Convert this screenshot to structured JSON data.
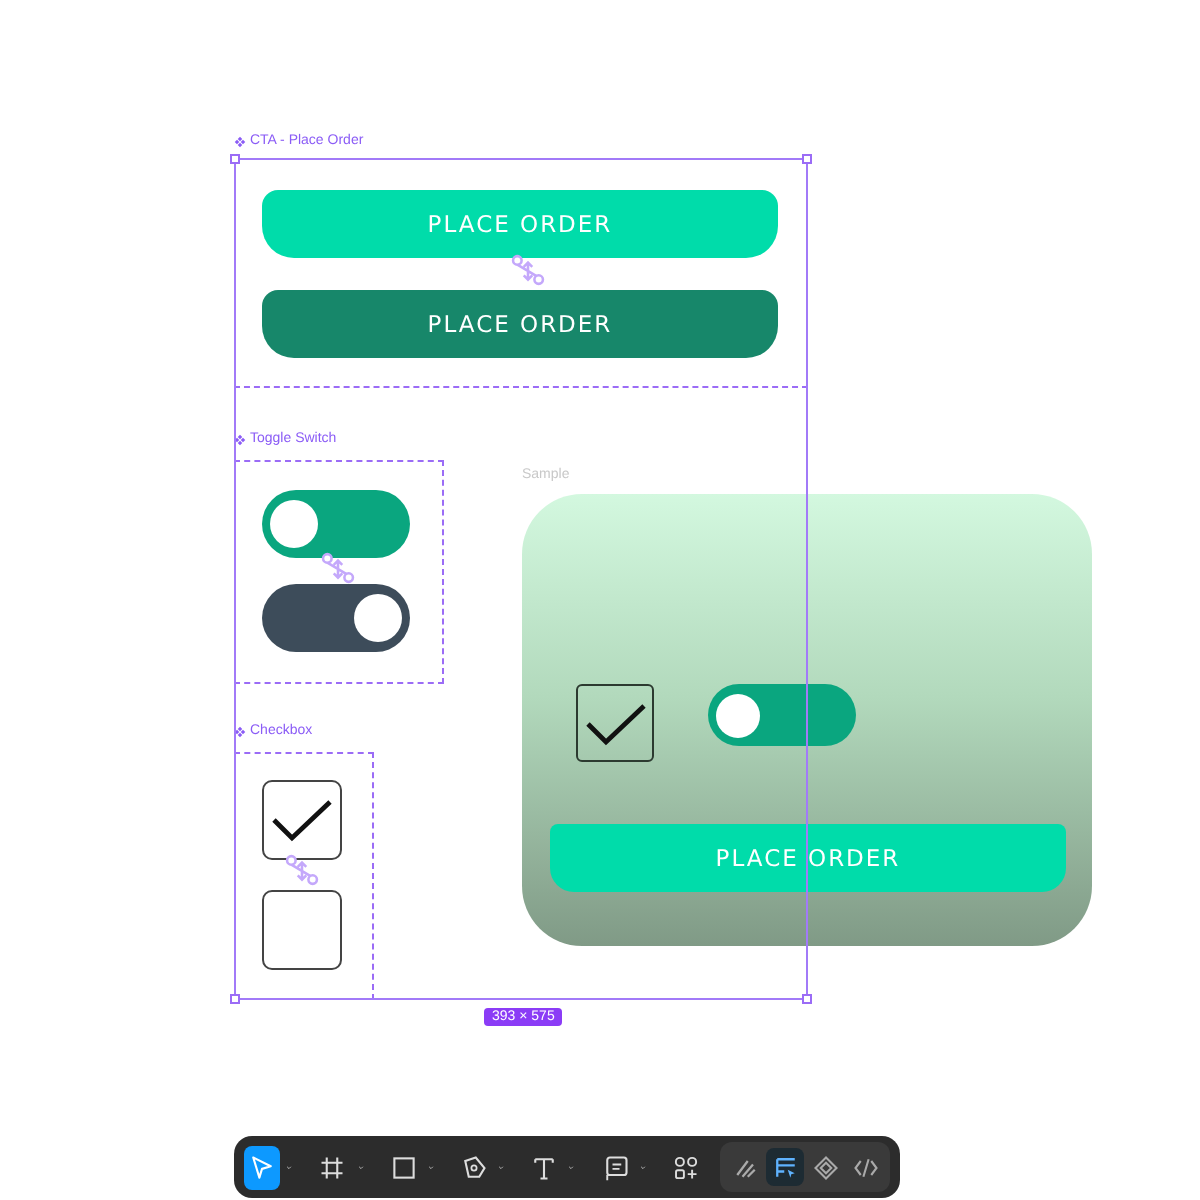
{
  "selection": {
    "size": "393 × 575"
  },
  "component_sets": [
    {
      "kind": "buttons",
      "label": "CTA - Place Order",
      "items": [
        {
          "label": "PLACE ORDER",
          "pressed": false
        },
        {
          "label": "PLACE ORDER",
          "pressed": true
        }
      ]
    },
    {
      "kind": "toggles",
      "label": "Toggle Switch",
      "items": [
        {
          "kind": "default"
        },
        {
          "kind": "alternate"
        }
      ]
    },
    {
      "kind": "checkboxes",
      "label": "Checkbox",
      "items": [
        {
          "checked": true
        },
        {
          "checked": false
        }
      ]
    }
  ],
  "sample": {
    "label": "Sample",
    "checkbox": {
      "checked": true
    },
    "toggle": {
      "kind": "default"
    },
    "button": {
      "label": "PLACE ORDER"
    }
  },
  "toolbar": {
    "tools": [
      {
        "selected": true,
        "dropdown": true
      },
      {
        "selected": false,
        "dropdown": true
      },
      {
        "selected": false,
        "dropdown": true
      },
      {
        "selected": false,
        "dropdown": true
      },
      {
        "selected": false,
        "dropdown": true
      },
      {
        "selected": false,
        "dropdown": true
      },
      {
        "selected": false,
        "dropdown": false
      }
    ],
    "modes": [
      {
        "selected": false
      },
      {
        "selected": true
      },
      {
        "selected": false
      },
      {
        "selected": false
      }
    ]
  }
}
